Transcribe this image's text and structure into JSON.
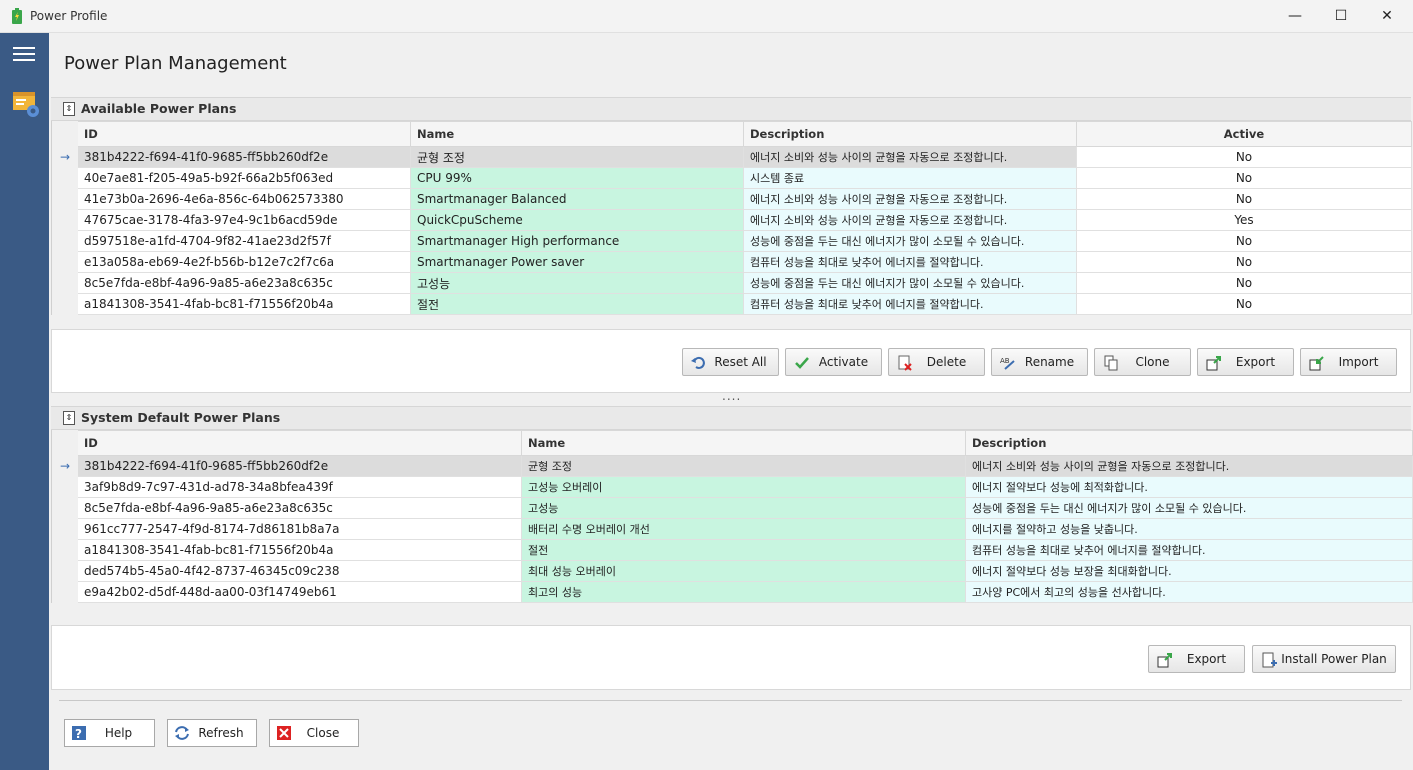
{
  "window": {
    "title": "Power Profile",
    "minimize": "—",
    "maximize": "☐",
    "close": "✕"
  },
  "page_title": "Power Plan Management",
  "available": {
    "header": "Available Power Plans",
    "columns": {
      "id": "ID",
      "name": "Name",
      "description": "Description",
      "active": "Active"
    },
    "rows": [
      {
        "id": "381b4222-f694-41f0-9685-ff5bb260df2e",
        "name": "균형 조정",
        "description": "에너지 소비와 성능 사이의 균형을 자동으로 조정합니다.",
        "active": "No"
      },
      {
        "id": "40e7ae81-f205-49a5-b92f-66a2b5f063ed",
        "name": "CPU 99%",
        "description": "시스템 종료",
        "active": "No"
      },
      {
        "id": "41e73b0a-2696-4e6a-856c-64b062573380",
        "name": "Smartmanager Balanced",
        "description": "에너지 소비와 성능 사이의 균형을 자동으로 조정합니다.",
        "active": "No"
      },
      {
        "id": "47675cae-3178-4fa3-97e4-9c1b6acd59de",
        "name": "QuickCpuScheme",
        "description": "에너지 소비와 성능 사이의 균형을 자동으로 조정합니다.",
        "active": "Yes"
      },
      {
        "id": "d597518e-a1fd-4704-9f82-41ae23d2f57f",
        "name": "Smartmanager High performance",
        "description": "성능에 중점을 두는 대신 에너지가 많이 소모될 수 있습니다.",
        "active": "No"
      },
      {
        "id": "e13a058a-eb69-4e2f-b56b-b12e7c2f7c6a",
        "name": "Smartmanager Power saver",
        "description": "컴퓨터 성능을 최대로 낮추어 에너지를 절약합니다.",
        "active": "No"
      },
      {
        "id": "8c5e7fda-e8bf-4a96-9a85-a6e23a8c635c",
        "name": "고성능",
        "description": "성능에 중점을 두는 대신 에너지가 많이 소모될 수 있습니다.",
        "active": "No"
      },
      {
        "id": "a1841308-3541-4fab-bc81-f71556f20b4a",
        "name": "절전",
        "description": "컴퓨터 성능을 최대로 낮추어 에너지를 절약합니다.",
        "active": "No"
      }
    ],
    "buttons": {
      "reset_all": "Reset All",
      "activate": "Activate",
      "delete": "Delete",
      "rename": "Rename",
      "clone": "Clone",
      "export": "Export",
      "import": "Import"
    }
  },
  "splitter": "....",
  "system_default": {
    "header": "System Default Power Plans",
    "columns": {
      "id": "ID",
      "name": "Name",
      "description": "Description"
    },
    "rows": [
      {
        "id": "381b4222-f694-41f0-9685-ff5bb260df2e",
        "name": "균형 조정",
        "description": "에너지 소비와 성능 사이의 균형을 자동으로 조정합니다."
      },
      {
        "id": "3af9b8d9-7c97-431d-ad78-34a8bfea439f",
        "name": "고성능 오버레이",
        "description": "에너지 절약보다 성능에 최적화합니다."
      },
      {
        "id": "8c5e7fda-e8bf-4a96-9a85-a6e23a8c635c",
        "name": "고성능",
        "description": "성능에 중점을 두는 대신 에너지가 많이 소모될 수 있습니다."
      },
      {
        "id": "961cc777-2547-4f9d-8174-7d86181b8a7a",
        "name": "배터리 수명 오버레이 개선",
        "description": "에너지를 절약하고 성능을 낮춥니다."
      },
      {
        "id": "a1841308-3541-4fab-bc81-f71556f20b4a",
        "name": "절전",
        "description": "컴퓨터 성능을 최대로 낮추어 에너지를 절약합니다."
      },
      {
        "id": "ded574b5-45a0-4f42-8737-46345c09c238",
        "name": "최대 성능 오버레이",
        "description": "에너지 절약보다 성능 보장을 최대화합니다."
      },
      {
        "id": "e9a42b02-d5df-448d-aa00-03f14749eb61",
        "name": "최고의 성능",
        "description": "고사양 PC에서 최고의 성능을 선사합니다."
      }
    ],
    "buttons": {
      "export": "Export",
      "install": "Install Power Plan"
    }
  },
  "footer": {
    "help": "Help",
    "refresh": "Refresh",
    "close": "Close"
  },
  "row_indicator": "→"
}
